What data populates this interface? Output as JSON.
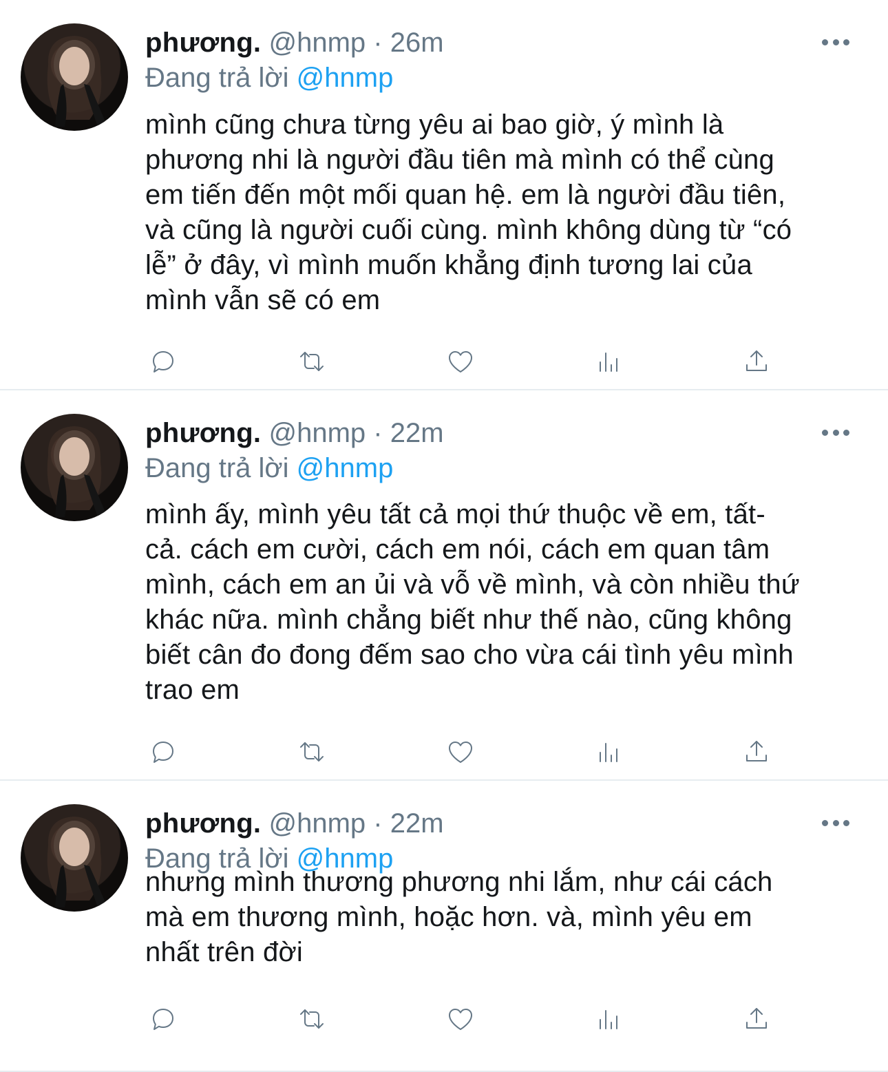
{
  "tweets": [
    {
      "name": "phương.",
      "handle": "@hnmp",
      "separator": "·",
      "time": "26m",
      "replying_prefix": "Đang trả lời",
      "replying_to": "@hnmp",
      "text": "mình cũng chưa từng yêu ai bao giờ, ý mình là\nphương nhi là người đầu tiên mà mình có thể cùng\nem tiến đến một mối quan hệ. em là người đầu tiên,\nvà cũng là người cuối cùng. mình không dùng từ “có\nlễ” ở đây, vì mình muốn khẳng định tương lai của\nmình vẫn sẽ có em"
    },
    {
      "name": "phương.",
      "handle": "@hnmp",
      "separator": "·",
      "time": "22m",
      "replying_prefix": "Đang trả lời",
      "replying_to": "@hnmp",
      "text": "mình ấy, mình yêu tất cả mọi thứ thuộc về em, tất-\ncả. cách em cười, cách em nói, cách em quan tâm\nmình, cách em an ủi và vỗ về mình, và còn nhiều thứ\nkhác nữa. mình chẳng biết như thế nào, cũng không\nbiết cân đo đong đếm sao cho vừa cái tình yêu mình\ntrao em"
    },
    {
      "name": "phương.",
      "handle": "@hnmp",
      "separator": "·",
      "time": "22m",
      "replying_prefix": "Đang trả lời",
      "replying_to": "@hnmp",
      "text": "nhưng mình thương phương nhi lắm, như cái cách\nmà em thương mình, hoặc hơn. và, mình yêu em\nnhất trên đời"
    }
  ],
  "icons": {
    "reply": "reply-icon",
    "retweet": "retweet-icon",
    "like": "heart-icon",
    "analytics": "analytics-icon",
    "share": "share-icon",
    "more": "more-icon"
  },
  "colors": {
    "text": "#14171a",
    "secondary": "#657786",
    "link": "#1da1f2",
    "divider": "#e6ecf0"
  }
}
